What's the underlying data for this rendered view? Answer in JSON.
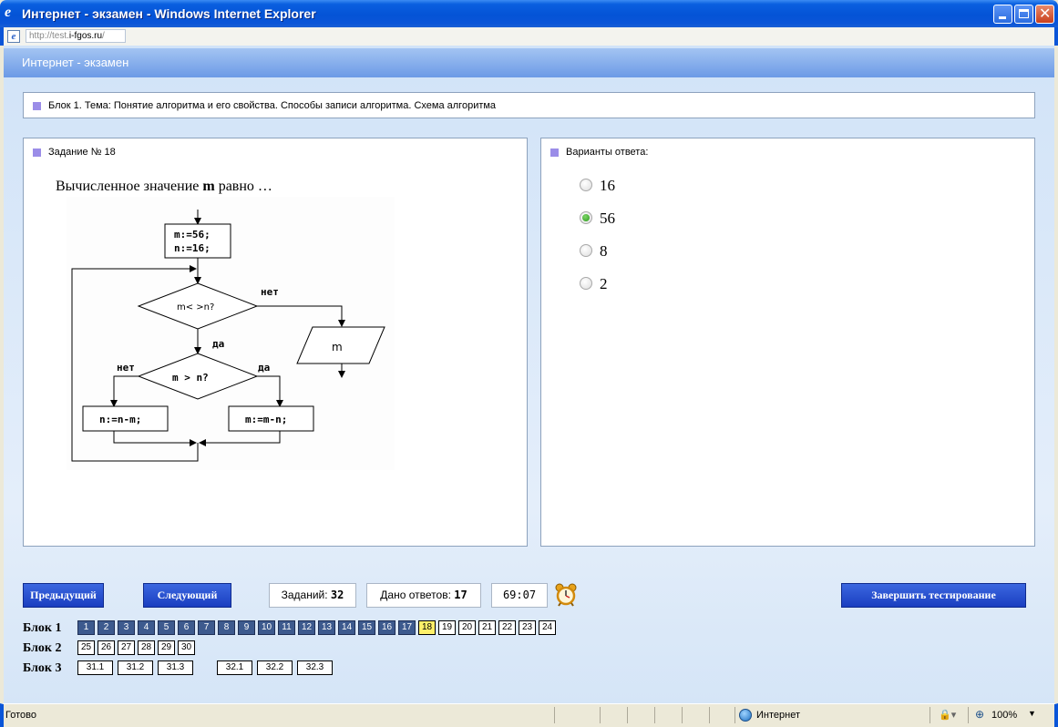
{
  "window": {
    "title": "Интернет - экзамен - Windows Internet Explorer",
    "address_prefix": "http://test.",
    "address_host": "i-fgos.ru",
    "address_suffix": "/"
  },
  "page": {
    "header": "Интернет - экзамен",
    "topic": "Блок 1. Тема: Понятие алгоритма и его свойства. Способы записи алгоритма. Схема алгоритма",
    "task_title": "Задание № 18",
    "question_pre": "Вычисленное значение ",
    "question_bold": "m",
    "question_post": " равно …",
    "flowchart": {
      "init_1": "m:=56;",
      "init_2": "n:=16;",
      "cond_1": "m< >n?",
      "no_1": "нет",
      "yes_1": "да",
      "cond_2": "m > n?",
      "no_2": "нет",
      "yes_2": "да",
      "output": "m",
      "assign_left": "n:=n-m;",
      "assign_right": "m:=m-n;"
    },
    "answers_title": "Варианты ответа:",
    "options": [
      {
        "label": "16",
        "selected": false
      },
      {
        "label": "56",
        "selected": true
      },
      {
        "label": "8",
        "selected": false
      },
      {
        "label": "2",
        "selected": false
      }
    ]
  },
  "controls": {
    "prev_label": "Предыдущий",
    "next_label": "Следующий",
    "tasks_label": "Заданий:",
    "tasks_count": "32",
    "answered_label": "Дано ответов:",
    "answered_count": "17",
    "timer": "69:07",
    "alarm_icon": "alarm-clock-icon",
    "finish_label": "Завершить тестирование"
  },
  "blocks": [
    {
      "label": "Блок 1",
      "items": [
        "1",
        "2",
        "3",
        "4",
        "5",
        "6",
        "7",
        "8",
        "9",
        "10",
        "11",
        "12",
        "13",
        "14",
        "15",
        "16",
        "17",
        "18",
        "19",
        "20",
        "21",
        "22",
        "23",
        "24"
      ],
      "answered_through": 17,
      "current": "18"
    },
    {
      "label": "Блок 2",
      "items": [
        "25",
        "26",
        "27",
        "28",
        "29",
        "30"
      ]
    },
    {
      "label": "Блок 3",
      "items_a": [
        "31.1",
        "31.2",
        "31.3"
      ],
      "items_b": [
        "32.1",
        "32.2",
        "32.3"
      ]
    }
  ],
  "statusbar": {
    "status": "Готово",
    "zone": "Интернет",
    "zoom": "100%"
  },
  "colors": {
    "title_bar": "#0453d6",
    "answered_cell": "#3d5a8e",
    "current_cell": "#fff06a",
    "nav_button": "#1a3ec0",
    "selected_radio": "#2a9a1a"
  }
}
